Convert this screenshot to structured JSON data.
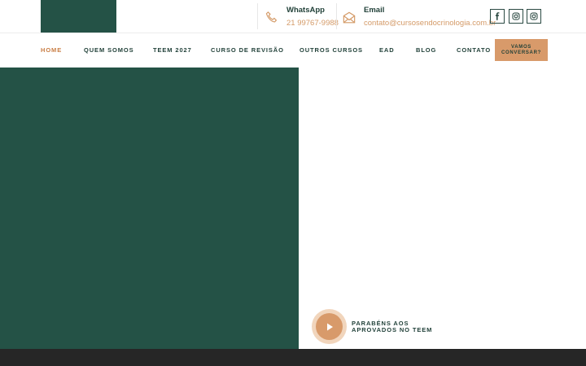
{
  "header": {
    "whatsapp": {
      "label": "WhatsApp",
      "value": "21 99767-9988",
      "icon": "phone-icon"
    },
    "email": {
      "label": "Email",
      "value": "contato@cursosendocrinologia.com.br",
      "icon": "envelope-icon"
    },
    "social": [
      "facebook-icon",
      "instagram-icon",
      "instagram-icon"
    ]
  },
  "nav": {
    "items": [
      {
        "label": "HOME",
        "active": true
      },
      {
        "label": "QUEM SOMOS"
      },
      {
        "label": "TEEM 2027"
      },
      {
        "label": "CURSO DE REVISÃO"
      },
      {
        "label": "OUTROS CURSOS"
      },
      {
        "label": "EAD"
      },
      {
        "label": "BLOG"
      },
      {
        "label": "CONTATO"
      }
    ],
    "cta_line1": "VAMOS",
    "cta_line2": "CONVERSAR?"
  },
  "hero": {
    "video_caption_line1": "PARABÉNS AOS",
    "video_caption_line2": "APROVADOS NO TEEM"
  },
  "colors": {
    "brand_green": "#245246",
    "accent": "#d89a6a",
    "footer": "#262626"
  }
}
